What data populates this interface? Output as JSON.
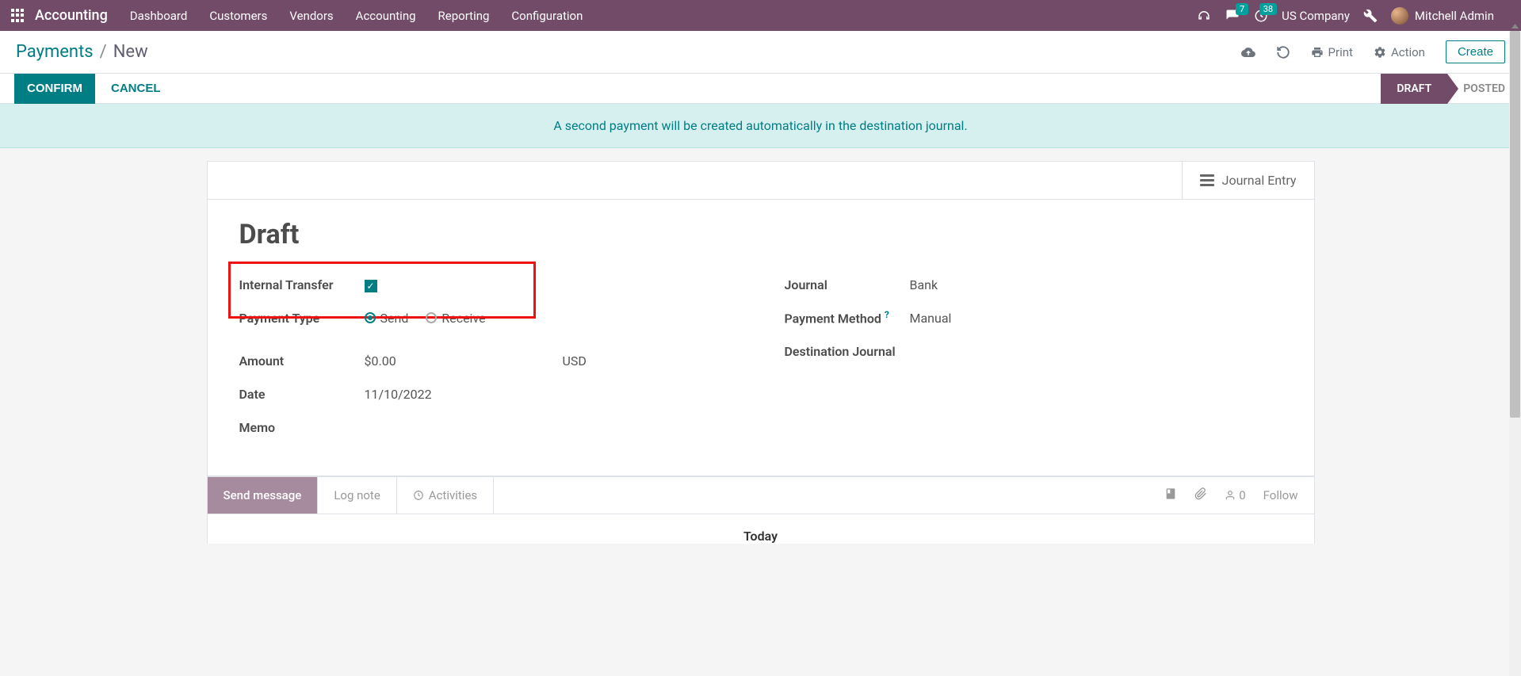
{
  "topnav": {
    "app": "Accounting",
    "menus": [
      "Dashboard",
      "Customers",
      "Vendors",
      "Accounting",
      "Reporting",
      "Configuration"
    ],
    "messages_badge": "7",
    "activities_badge": "38",
    "company": "US Company",
    "user": "Mitchell Admin"
  },
  "breadcrumb": {
    "root": "Payments",
    "current": "New"
  },
  "cp": {
    "print": "Print",
    "action": "Action",
    "create": "Create"
  },
  "statusbar": {
    "confirm": "CONFIRM",
    "cancel": "CANCEL",
    "draft": "DRAFT",
    "posted": "POSTED"
  },
  "banner": "A second payment will be created automatically in the destination journal.",
  "sheet": {
    "journal_entry": "Journal Entry",
    "title": "Draft",
    "left": {
      "internal_transfer": "Internal Transfer",
      "payment_type": "Payment Type",
      "send": "Send",
      "receive": "Receive",
      "amount_label": "Amount",
      "amount": "$0.00",
      "currency": "USD",
      "date_label": "Date",
      "date": "11/10/2022",
      "memo_label": "Memo"
    },
    "right": {
      "journal_label": "Journal",
      "journal": "Bank",
      "method_label": "Payment Method",
      "method": "Manual",
      "dest_label": "Destination Journal"
    }
  },
  "chatter": {
    "send": "Send message",
    "log": "Log note",
    "activities": "Activities",
    "followers": "0",
    "follow": "Follow",
    "today": "Today"
  }
}
